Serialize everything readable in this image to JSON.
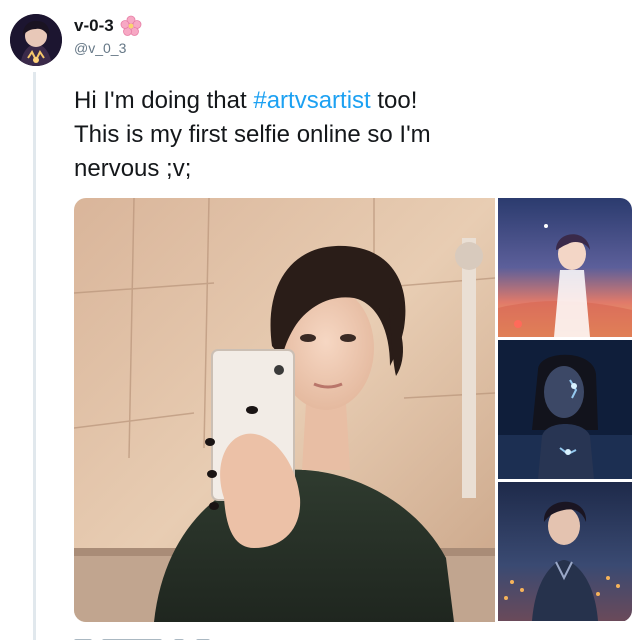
{
  "tweet": {
    "display_name": "v-0-3",
    "name_emoji": "🌸",
    "handle": "@v_0_3",
    "text_before": "Hi I'm doing that ",
    "hashtag": "#artvsartist",
    "text_after": " too!\nThis is my first selfie online so I'm\nnervous ;v;",
    "colors": {
      "hashtag": "#1da1f2",
      "handle": "#657786",
      "text": "#14171a",
      "thread_line": "#e1e8ed"
    }
  },
  "media": {
    "main_photo_icon": "selfie-photo",
    "thumb_1_icon": "anime-sunset-artwork",
    "thumb_2_icon": "anime-night-glow-artwork",
    "thumb_3_icon": "anime-city-night-artwork"
  }
}
